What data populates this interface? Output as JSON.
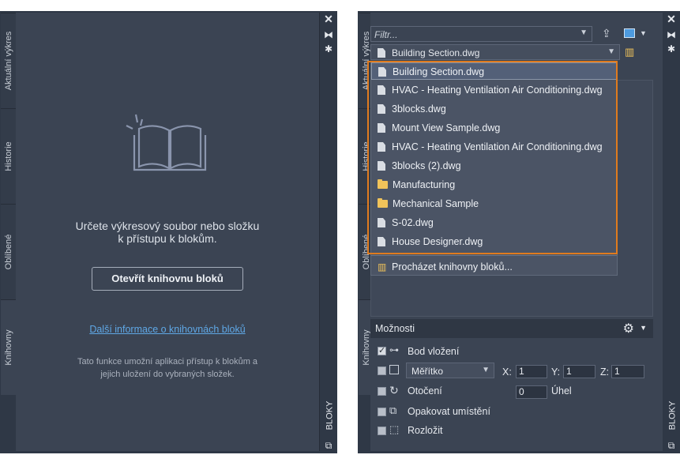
{
  "left_panel": {
    "tabs": [
      "Aktuální výkres",
      "Historie",
      "Oblíbené",
      "Knihovny"
    ],
    "message_line1": "Určete výkresový soubor nebo složku",
    "message_line2": "k přístupu k blokům.",
    "open_button": "Otevřít knihovnu bloků",
    "more_info_link": "Další informace o knihovnách bloků",
    "info_line1": "Tato funkce umožní aplikaci přístup k blokům a",
    "info_line2": "jejich uložení do vybraných složek.",
    "panel_title": "BLOKY"
  },
  "right_panel": {
    "tabs": [
      "Aktuální výkres",
      "Historie",
      "Oblíbené",
      "Knihovny"
    ],
    "filter_placeholder": "Filtr...",
    "selected_file": "Building Section.dwg",
    "dropdown_items": [
      {
        "label": "Building Section.dwg",
        "icon": "document-icon"
      },
      {
        "label": "HVAC - Heating Ventilation Air Conditioning.dwg",
        "icon": "document-icon"
      },
      {
        "label": "3blocks.dwg",
        "icon": "document-icon"
      },
      {
        "label": "Mount View Sample.dwg",
        "icon": "document-icon"
      },
      {
        "label": "HVAC - Heating Ventilation Air Conditioning.dwg",
        "icon": "document-icon"
      },
      {
        "label": "3blocks (2).dwg",
        "icon": "document-icon"
      },
      {
        "label": "Manufacturing",
        "icon": "folder-icon"
      },
      {
        "label": "Mechanical Sample",
        "icon": "folder-icon"
      },
      {
        "label": "S-02.dwg",
        "icon": "document-icon"
      },
      {
        "label": "House Designer.dwg",
        "icon": "document-icon"
      }
    ],
    "browse_label": "Procházet knihovny bloků...",
    "options_title": "Možnosti",
    "insertion_point": "Bod vložení",
    "scale_select": "Měřítko",
    "x_label": "X:",
    "x_value": "1",
    "y_label": "Y:",
    "y_value": "1",
    "z_label": "Z:",
    "z_value": "1",
    "rotation": "Otočení",
    "angle_value": "0",
    "angle_label": "Úhel",
    "repeat_placement": "Opakovat umístění",
    "explode": "Rozložit",
    "panel_title": "BLOKY"
  },
  "colors": {
    "panel_bg": "#3b4453",
    "accent_orange": "#e07b1e",
    "link_blue": "#5fa8e6"
  }
}
